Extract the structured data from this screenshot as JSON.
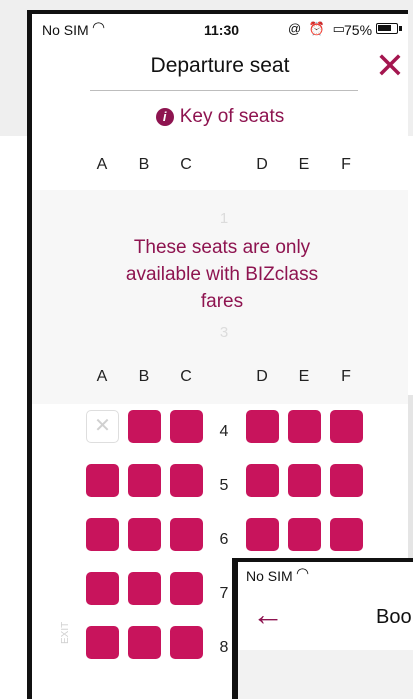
{
  "status_bar": {
    "carrier": "No SIM",
    "wifi_icon": "wifi-icon",
    "time": "11:30",
    "icons": "@ ⏰ ▭",
    "battery": "75%"
  },
  "header": {
    "title": "Departure seat",
    "close_icon": "close-icon"
  },
  "key_of_seats": {
    "label": "Key of seats",
    "icon": "info-icon"
  },
  "columns": [
    "A",
    "B",
    "C",
    "D",
    "E",
    "F"
  ],
  "biz_section": {
    "row_before": "1",
    "message_line1": "These seats are only",
    "message_line2": "available with BIZclass",
    "message_line3": "fares",
    "row_after": "3"
  },
  "rows": [
    {
      "number": "4",
      "seats": [
        "unavailable",
        "available",
        "available",
        "available",
        "available",
        "available"
      ]
    },
    {
      "number": "5",
      "seats": [
        "available",
        "available",
        "available",
        "available",
        "available",
        "available"
      ]
    },
    {
      "number": "6",
      "seats": [
        "available",
        "available",
        "available",
        "available",
        "available",
        "available"
      ]
    },
    {
      "number": "7",
      "seats": [
        "available",
        "available",
        "available",
        "available",
        "available",
        "available"
      ]
    },
    {
      "number": "8",
      "seats": [
        "available",
        "available",
        "available",
        "available",
        "available",
        "available"
      ]
    }
  ],
  "exit_label": "EXIT",
  "overlay": {
    "carrier": "No SIM",
    "wifi_icon": "wifi-icon",
    "back_icon": "back-arrow-icon",
    "title": "Boo"
  },
  "colors": {
    "accent": "#8e1450",
    "seat": "#c8145c"
  }
}
